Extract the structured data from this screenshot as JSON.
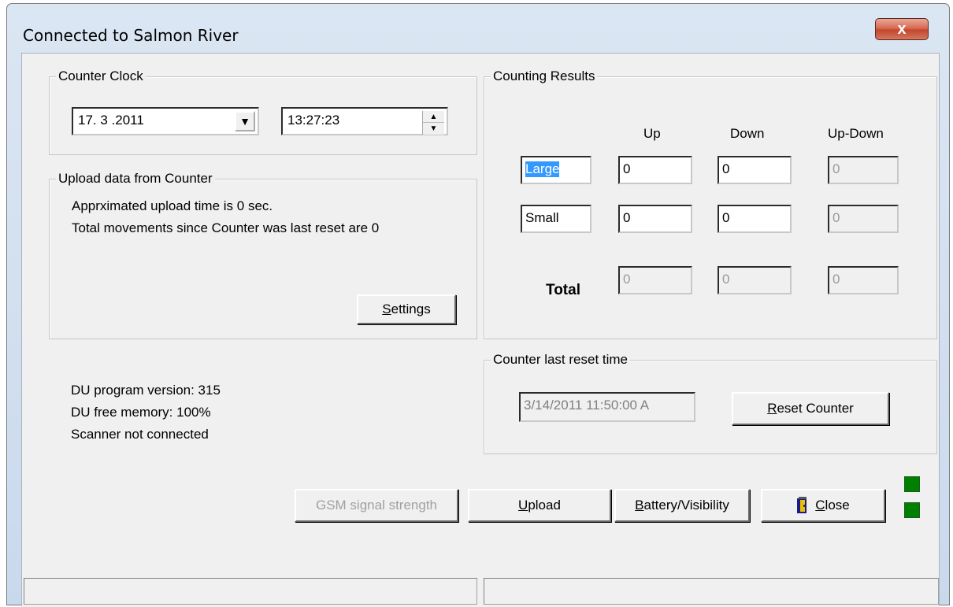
{
  "window": {
    "title": "Connected to Salmon River",
    "close_glyph": "x"
  },
  "counter_clock": {
    "title": "Counter Clock",
    "date": "17. 3 .2011",
    "time": "13:27:23"
  },
  "upload_group": {
    "title": "Upload data from Counter",
    "line1": "Apprximated upload time is 0 sec.",
    "line2": "Total movements since Counter was last reset are 0",
    "settings_label": "ettings",
    "settings_mnemonic": "S"
  },
  "info": {
    "program_version": "DU program version: 315",
    "free_memory": "DU free memory: 100%",
    "scanner": "Scanner not connected"
  },
  "results": {
    "title": "Counting Results",
    "headers": [
      "Up",
      "Down",
      "Up-Down"
    ],
    "rows": [
      {
        "label": "Large",
        "up": "0",
        "down": "0",
        "updown": "0"
      },
      {
        "label": "Small",
        "up": "0",
        "down": "0",
        "updown": "0"
      }
    ],
    "total_label": "Total",
    "total": {
      "up": "0",
      "down": "0",
      "updown": "0"
    }
  },
  "reset_group": {
    "title": "Counter last reset time",
    "time": "3/14/2011 11:50:00 A",
    "reset_mnemonic": "R",
    "reset_label": "eset Counter"
  },
  "buttons": {
    "gsm": "GSM signal strength",
    "upload_mnemonic": "U",
    "upload_rest": "pload",
    "battery_mnemonic": "B",
    "battery_rest": "attery/Visibility",
    "close_mnemonic": "C",
    "close_rest": "lose"
  },
  "colors": {
    "led": "#008000",
    "selection": "#3399ff"
  }
}
